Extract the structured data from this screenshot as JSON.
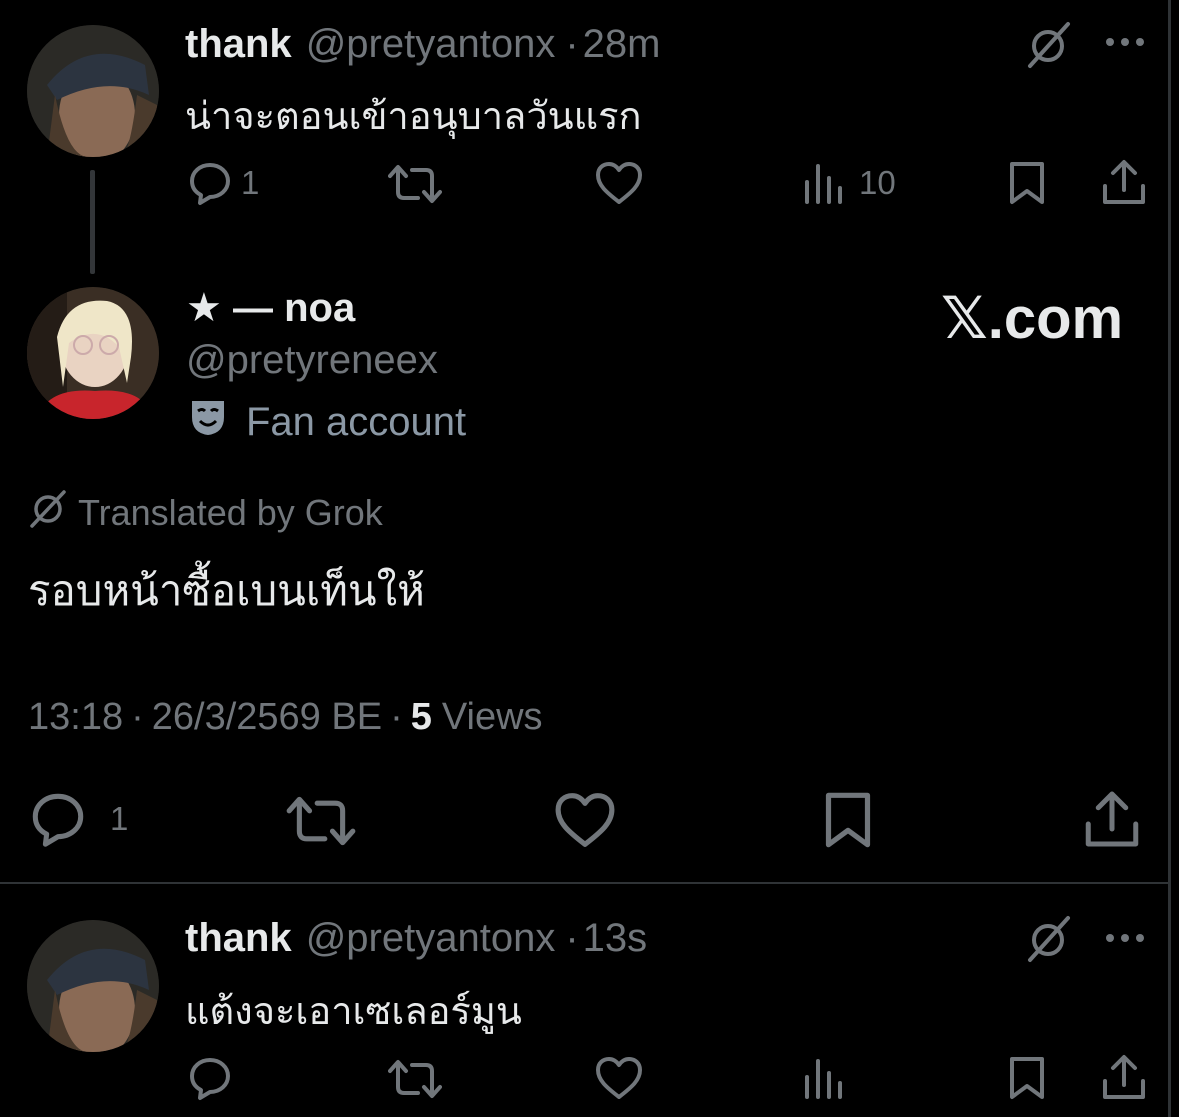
{
  "post1": {
    "display_name": "thank",
    "handle": "@pretyantonx",
    "separator": "·",
    "time": "28m",
    "text": "น่าจะตอนเข้าอนุบาลวันแรก",
    "actions": {
      "reply_count": "1",
      "views_count": "10"
    }
  },
  "main_post": {
    "display_name": "★ — noa",
    "handle": "@pretyreneex",
    "badge_icon": "theater-mask-icon",
    "badge_text": "Fan account",
    "watermark": "𝕏.com",
    "translated_label": "Translated by Grok",
    "text": "รอบหน้าซื้อเบนเท็นให้",
    "meta": {
      "time": "13:18",
      "sep1": "·",
      "date": "26/3/2569 BE",
      "sep2": "·",
      "views_number": "5",
      "views_label": "Views"
    },
    "actions": {
      "reply_count": "1"
    }
  },
  "post2": {
    "display_name": "thank",
    "handle": "@pretyantonx",
    "separator": "·",
    "time": "13s",
    "text": "แต้งจะเอาเซเลอร์มูน"
  },
  "icons": [
    "grok-icon",
    "more-icon",
    "reply-icon",
    "repost-icon",
    "like-icon",
    "views-icon",
    "bookmark-icon",
    "share-icon"
  ],
  "colors": {
    "background": "#000000",
    "text": "#e7e9ea",
    "muted": "#71767b",
    "divider": "#2f3336"
  }
}
